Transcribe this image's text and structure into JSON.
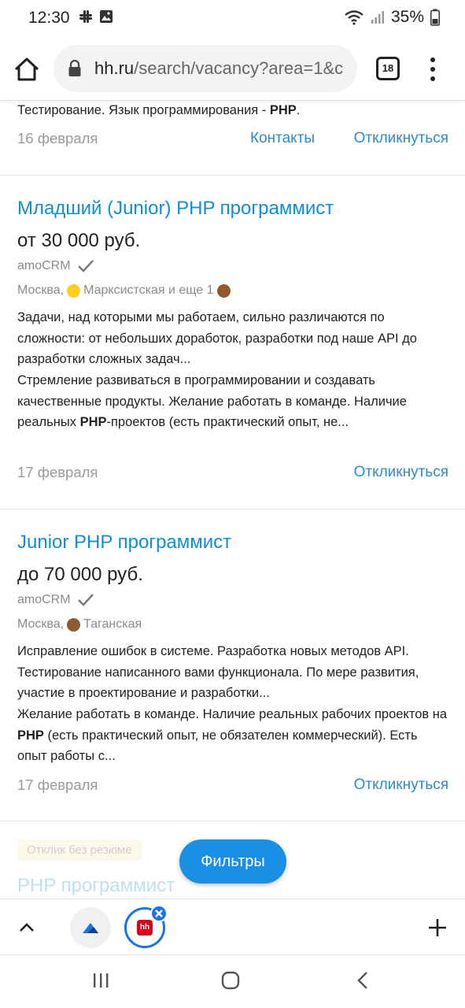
{
  "status_bar": {
    "time": "12:30",
    "battery": "35%"
  },
  "browser": {
    "url_domain": "hh.ru",
    "url_path": "/search/vacancy?area=1&c",
    "tab_count": "18"
  },
  "previous_item": {
    "desc_plain": "Тестирование. Язык программирования - ",
    "desc_bold": "PHP",
    "desc_end": ".",
    "date": "16 февраля",
    "contacts_label": "Контакты",
    "respond_label": "Откликнуться"
  },
  "vacancies": [
    {
      "title": "Младший (Junior) PHP программист",
      "salary": "от 30 000 руб.",
      "company": "amoCRM",
      "city": "Москва,",
      "metro": "Марксистская и еще 1",
      "metro_color": "#ffcd1c",
      "extra_metro_color": "#8d5b2d",
      "desc_1": "Задачи, над которыми мы работаем, сильно различаются по сложности: от небольших доработок, разработки под наше API до разработки сложных задач...",
      "desc_2_start": "Стремление развиваться в программировании и создавать качественные продукты. Желание работать в команде. Наличие реальных ",
      "desc_2_bold": "PHP",
      "desc_2_end": "-проектов (есть практический опыт, не...",
      "date": "17 февраля",
      "respond_label": "Откликнуться"
    },
    {
      "title": "Junior PHP программист",
      "salary": "до 70 000 руб.",
      "company": "amoCRM",
      "city": "Москва,",
      "metro": "Таганская",
      "metro_color": "#8d5b2d",
      "desc_1": "Исправление ошибок в системе. Разработка новых методов API. Тестирование написанного вами функционала. По мере развития, участие в проектирование и разработки...",
      "desc_2_start": "Желание работать в команде. Наличие реальных рабочих проектов на ",
      "desc_2_bold": "PHP",
      "desc_2_end": " (есть практический опыт, не обязателен коммерческий). Есть опыт работы с...",
      "date": "17 февраля",
      "respond_label": "Откликнуться"
    }
  ],
  "next_item": {
    "badge": "Отклик без резюме",
    "title": "PHP программист"
  },
  "filter_button": "Фильтры",
  "tab_strip": {
    "hh_label": "hh"
  },
  "colors": {
    "link": "#2e8bc9",
    "title": "#0f8ed6",
    "filter_button": "#1a8fe3"
  }
}
